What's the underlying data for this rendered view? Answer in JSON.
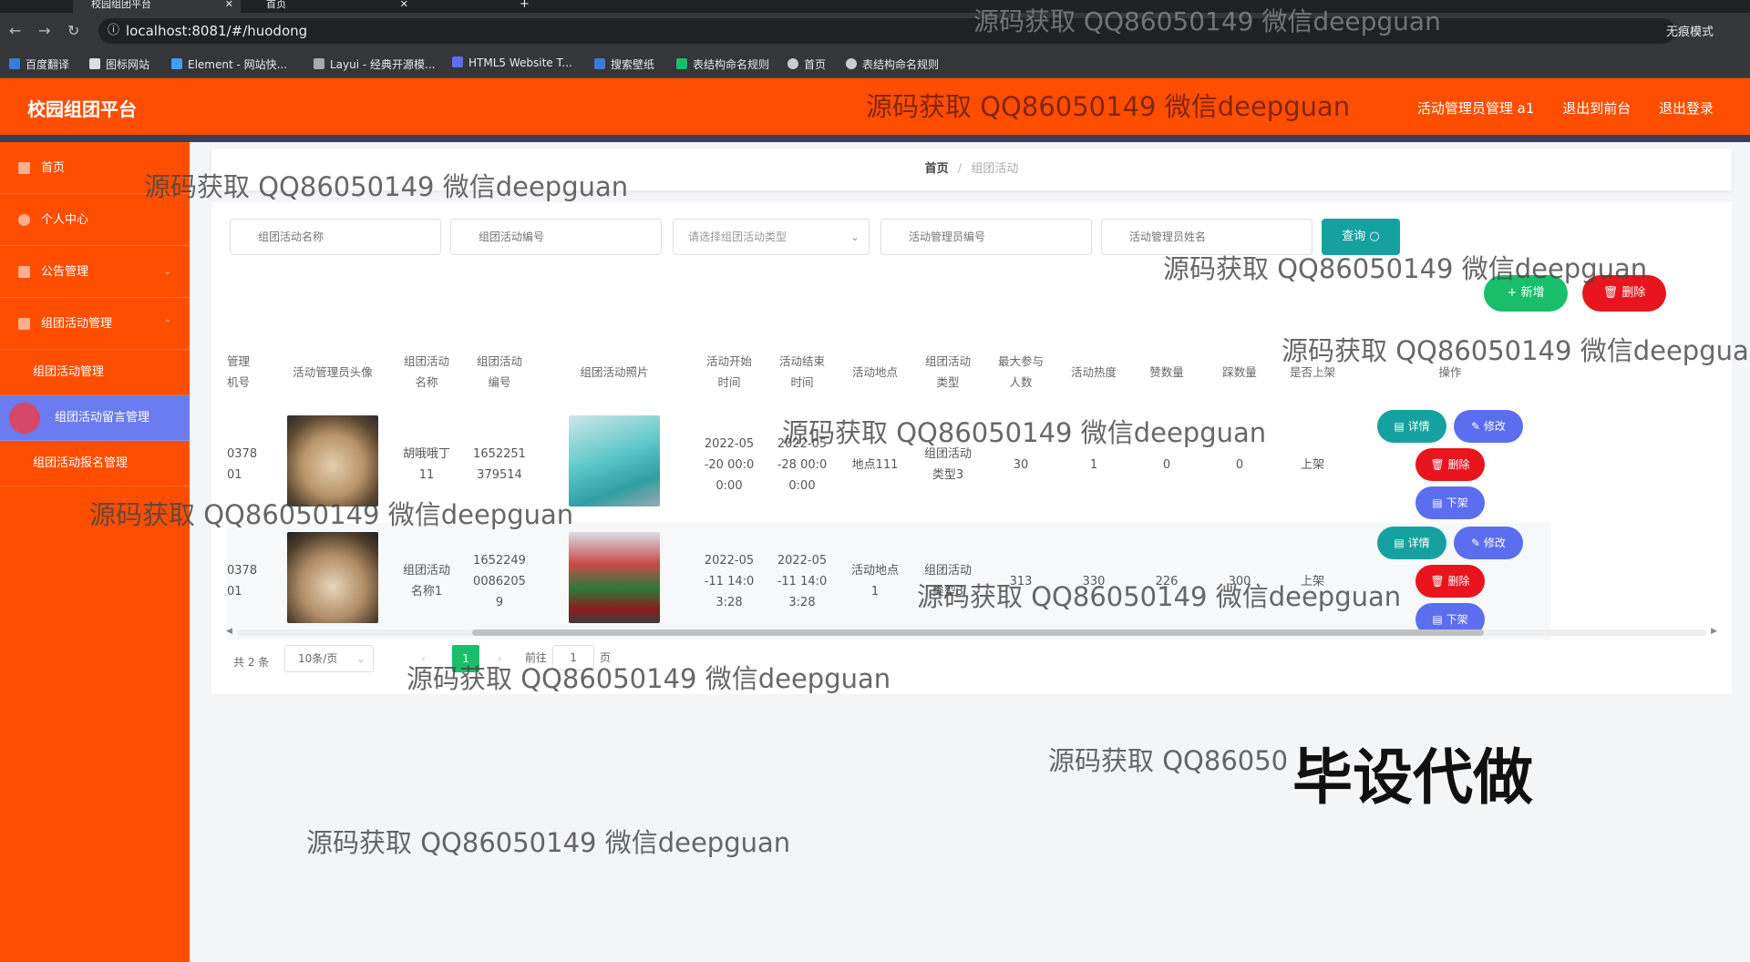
{
  "browser": {
    "tabs": [
      {
        "title": "校园组团平台"
      },
      {
        "title": "首页"
      }
    ],
    "url": "localhost:8081/#/huodong",
    "profile": "无痕模式",
    "bookmarks": [
      "百度翻译",
      "图标网站",
      "Element - 网站快...",
      "Layui - 经典开源模...",
      "HTML5 Website T...",
      "搜索壁纸",
      "表结构命名规则",
      "首页",
      "表结构命名规则"
    ]
  },
  "header": {
    "brand": "校园组团平台",
    "user": "活动管理员管理 a1",
    "to_front": "退出到前台",
    "logout": "退出登录"
  },
  "sidebar": {
    "home": "首页",
    "personal": "个人中心",
    "notice": "公告管理",
    "activity_group": "组团活动管理",
    "sub": [
      "组团活动管理",
      "组团活动留言管理",
      "组团活动报名管理"
    ]
  },
  "breadcrumb": {
    "home": "首页",
    "current": "组团活动"
  },
  "search": {
    "name_ph": "组团活动名称",
    "no_ph": "组团活动编号",
    "type_ph": "请选择组团活动类型",
    "admin_no_ph": "活动管理员编号",
    "admin_name_ph": "活动管理员姓名",
    "query": "查询"
  },
  "actions": {
    "add": "+ 新增",
    "delete": "删除"
  },
  "table": {
    "headers": [
      "管理\n机号",
      "活动管理员头像",
      "组团活动\n名称",
      "组团活动\n编号",
      "组团活动照片",
      "活动开始\n时间",
      "活动结束\n时间",
      "活动地点",
      "组团活动\n类型",
      "最大参与\n人数",
      "活动热度",
      "赞数量",
      "踩数量",
      "是否上架",
      "操作"
    ],
    "rows": [
      {
        "admin_no": "0378\n01",
        "name": "胡哦哦丁\n11",
        "no": "1652251\n379514",
        "start": "2022-05\n-20 00:0\n0:00",
        "end": "2022-05\n-28 00:0\n0:00",
        "place": "地点111",
        "type": "组团活动\n类型3",
        "max": "30",
        "heat": "1",
        "likes": "0",
        "dislikes": "0",
        "on_shelf": "上架"
      },
      {
        "admin_no": "0378\n01",
        "name": "组团活动\n名称1",
        "no": "1652249\n0086205\n9",
        "start": "2022-05\n-11 14:0\n3:28",
        "end": "2022-05\n-11 14:0\n3:28",
        "place": "活动地点\n1",
        "type": "组团活动\n类型3",
        "max": "313",
        "heat": "330",
        "likes": "226",
        "dislikes": "300",
        "on_shelf": "上架"
      }
    ],
    "op": {
      "detail": "详情",
      "edit": "修改",
      "delete": "删除",
      "offshelf": "下架"
    }
  },
  "pager": {
    "total": "共 2 条",
    "size": "10条/页",
    "page": "1",
    "goto": "前往",
    "goto_val": "1",
    "unit": "页"
  },
  "watermark": "源码获取 QQ86050149 微信deepguan",
  "watermark_partial": "源码获取 QQ86050",
  "banner": "毕设代做",
  "colors": {
    "primary": "#ff4e00",
    "active_menu": "#6b7bf0",
    "teal": "#16a1a1",
    "green": "#19be6b",
    "red": "#e8151e",
    "blue": "#5b6ef0"
  }
}
